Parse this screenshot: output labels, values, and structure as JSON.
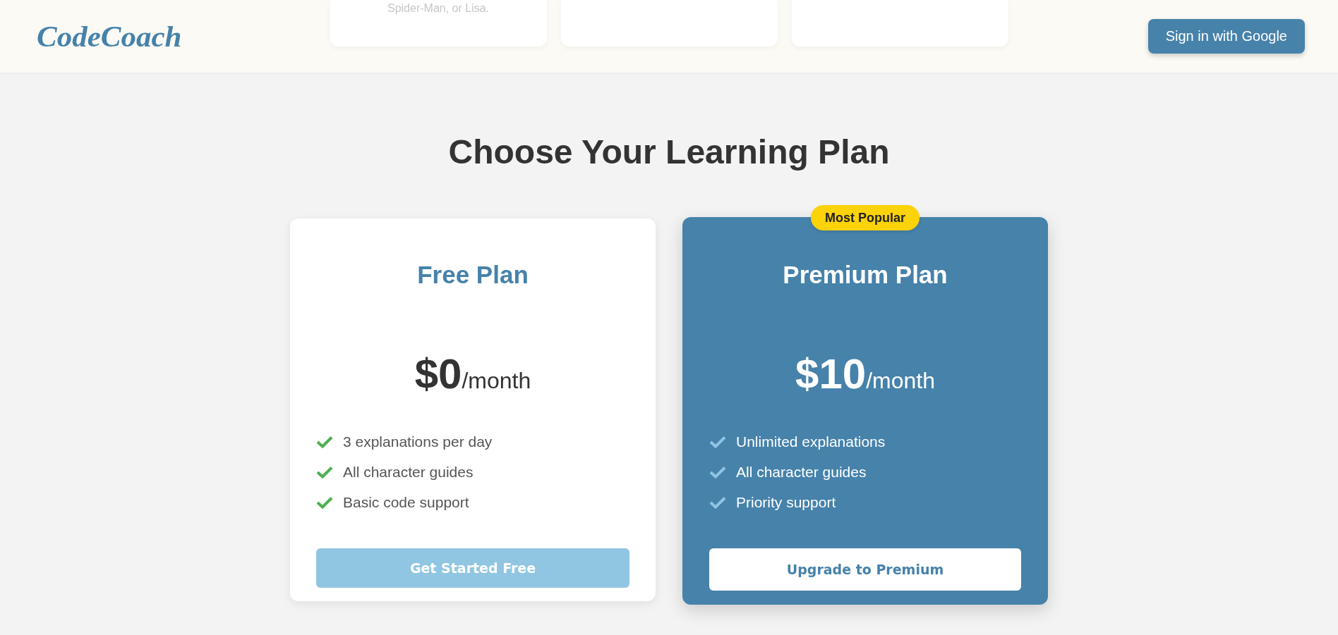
{
  "header": {
    "logo": "CodeCoach",
    "sign_in_button": "Sign in with Google"
  },
  "background_cards": [
    {
      "kind": "captioned",
      "caption": "Spider-Man, or Lisa."
    },
    {
      "kind": "blank"
    },
    {
      "kind": "blank"
    }
  ],
  "pricing": {
    "title": "Choose Your Learning Plan",
    "plans": [
      {
        "kind": "standard",
        "name": "Free Plan",
        "price": "$0",
        "period": "/month",
        "features": [
          "3 explanations per day",
          "All character guides",
          "Basic code support"
        ],
        "button": "Get Started Free"
      },
      {
        "kind": "featured",
        "badge": "Most Popular",
        "name": "Premium Plan",
        "price": "$10",
        "period": "/month",
        "features": [
          "Unlimited explanations",
          "All character guides",
          "Priority support"
        ],
        "button": "Upgrade to Premium"
      }
    ]
  }
}
